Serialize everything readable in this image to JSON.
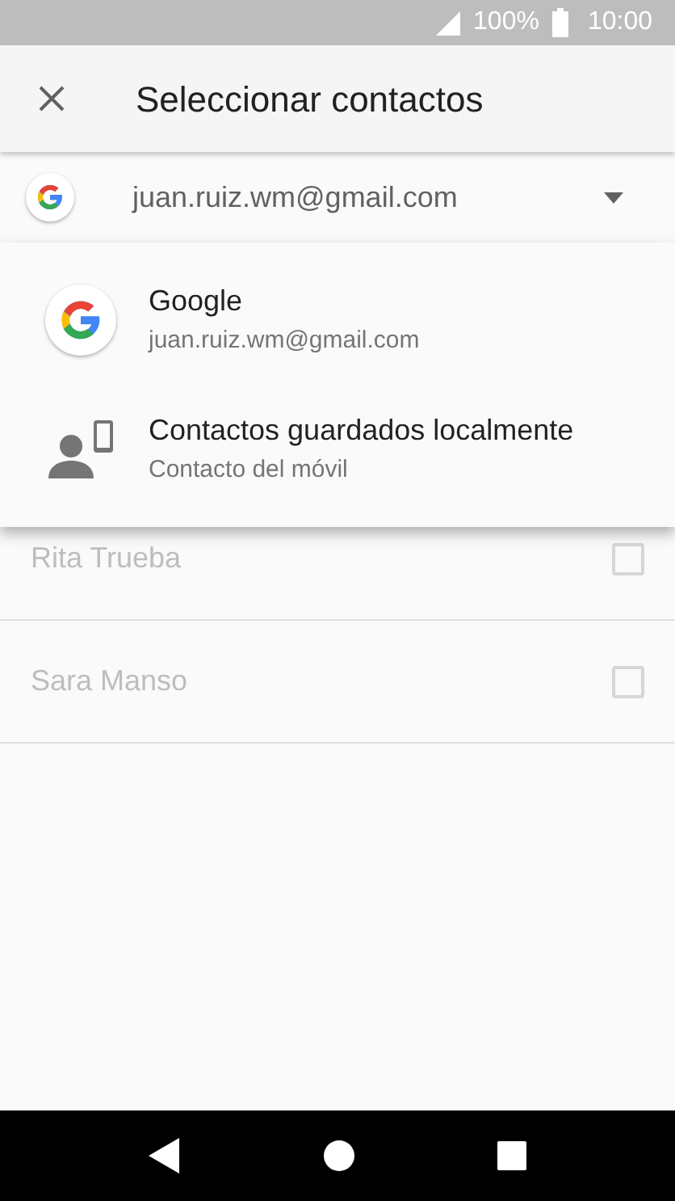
{
  "status_bar": {
    "battery": "100%",
    "time": "10:00"
  },
  "toolbar": {
    "title": "Seleccionar contactos"
  },
  "account_selector": {
    "value": "juan.ruiz.wm@gmail.com",
    "expanded": true
  },
  "account_menu": [
    {
      "kind": "google",
      "title": "Google",
      "subtitle": "juan.ruiz.wm@gmail.com"
    },
    {
      "kind": "device",
      "title": "Contactos guardados localmente",
      "subtitle": "Contacto del móvil"
    }
  ],
  "contacts": [
    {
      "name": "Rita Trueba",
      "checked": false
    },
    {
      "name": "Sara Manso",
      "checked": false
    }
  ]
}
